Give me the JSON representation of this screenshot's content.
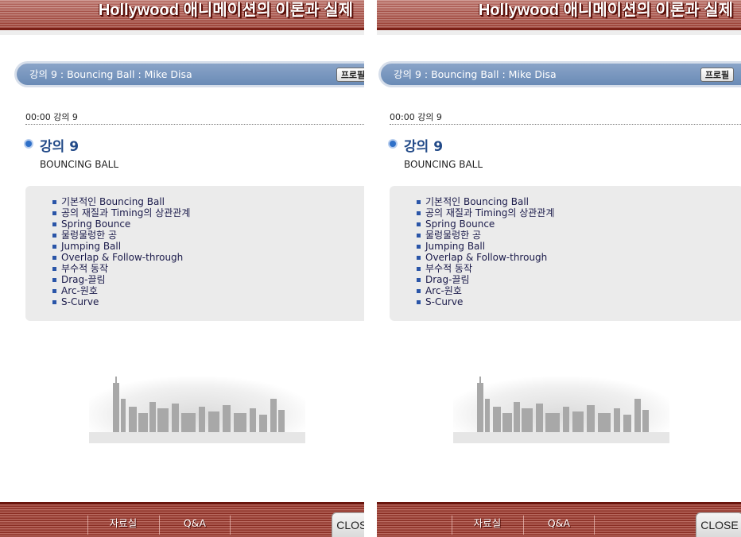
{
  "header": {
    "title": "Hollywood 애니메이션의 이론과 실제"
  },
  "lecture": {
    "bar_title": "강의 9 : Bouncing Ball : Mike Disa",
    "profile_button": "프로필",
    "time_label": "00:00 강의 9",
    "heading": "강의 9",
    "subtitle": "BOUNCING BALL",
    "topics": [
      "기본적인 Bouncing Ball",
      "공의 재질과 Timing의 상관관계",
      "Spring Bounce",
      "물렁물렁한 공",
      "Jumping Ball",
      "Overlap & Follow-through",
      "부수적 동작",
      "Drag-끌림",
      "Arc-원호",
      "S-Curve"
    ]
  },
  "footer": {
    "archive": "자료실",
    "qa": "Q&A",
    "close": "CLOSE"
  },
  "colors": {
    "banner": "#a44a40",
    "lecture_bar": "#6a8bb6",
    "heading": "#224a88",
    "topics_bg": "#ebebeb"
  }
}
